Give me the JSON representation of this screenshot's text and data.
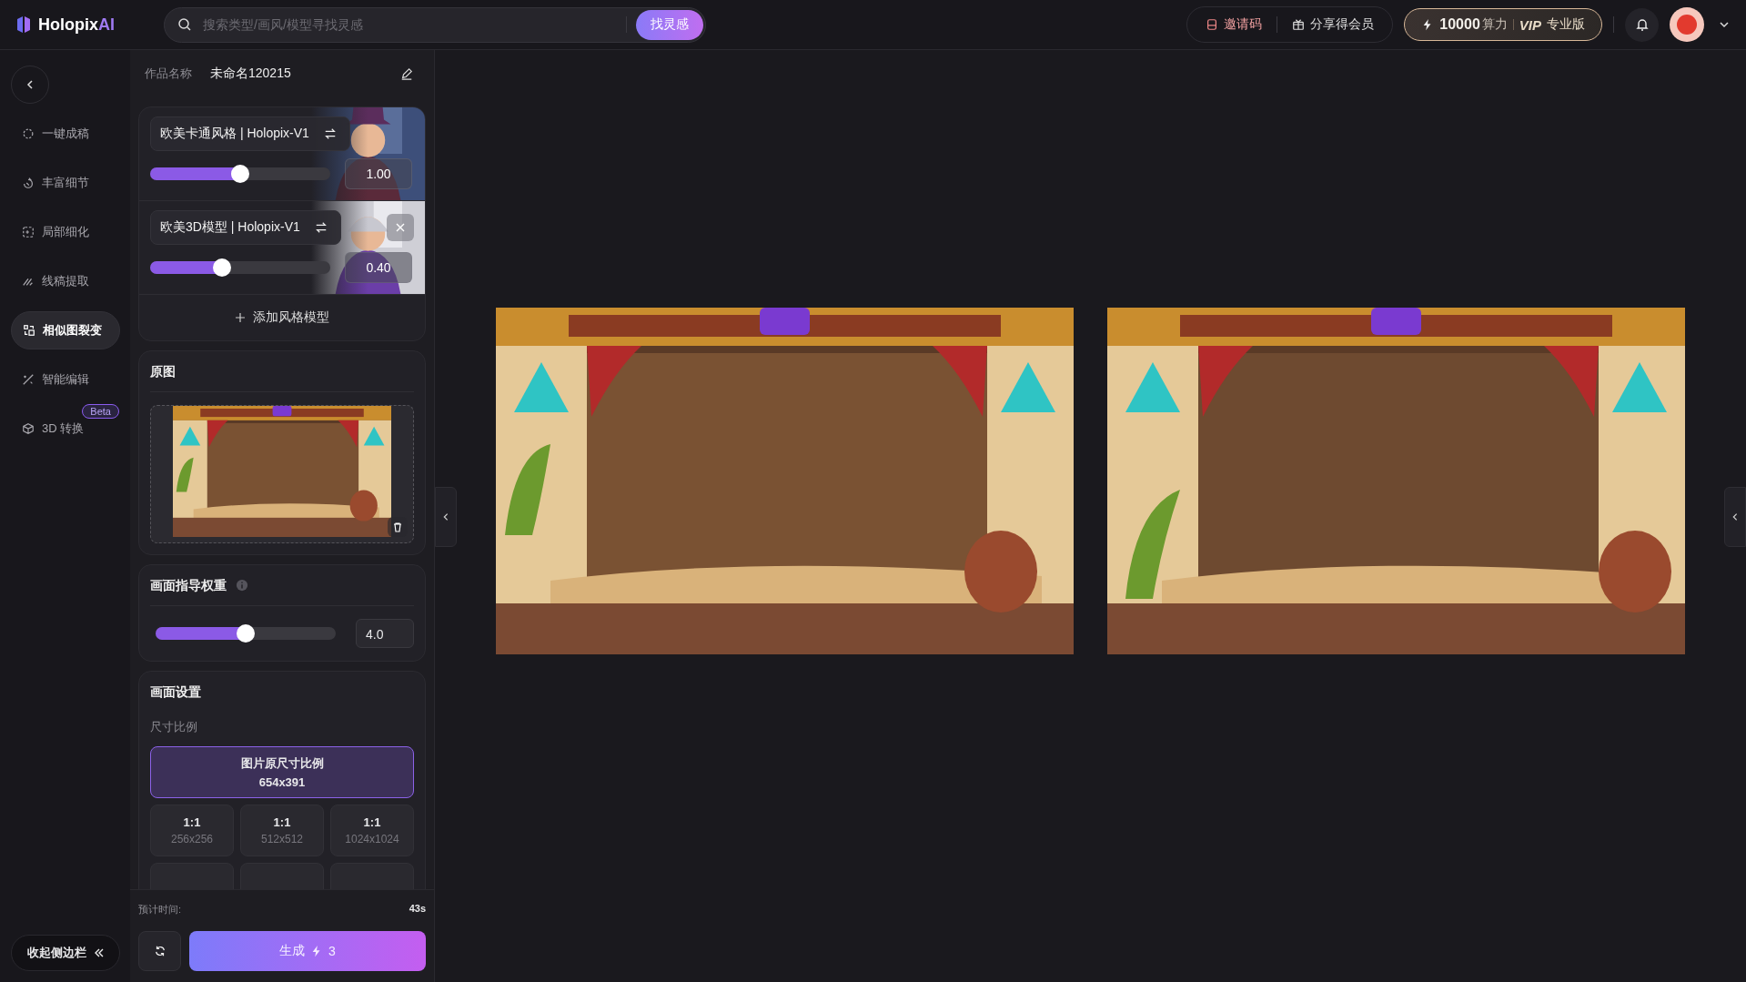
{
  "logo": {
    "name": "Holopix",
    "accent": "AI"
  },
  "search": {
    "placeholder": "搜索类型/画风/模型寻找灵感",
    "button": "找灵感"
  },
  "header": {
    "invite": "邀请码",
    "share": "分享得会员",
    "credits": "10000",
    "credits_unit": "算力",
    "vip": "VIP",
    "plan": "专业版"
  },
  "nav": [
    {
      "label": "一键成稿",
      "selected": false
    },
    {
      "label": "丰富细节",
      "selected": false
    },
    {
      "label": "局部细化",
      "selected": false
    },
    {
      "label": "线稿提取",
      "selected": false
    },
    {
      "label": "相似图裂变",
      "selected": true
    },
    {
      "label": "智能编辑",
      "selected": false
    },
    {
      "label": "3D 转换",
      "selected": false,
      "badge": "Beta"
    }
  ],
  "collapse": "收起侧边栏",
  "work": {
    "label": "作品名称",
    "value": "未命名120215"
  },
  "style_models": [
    {
      "name": "欧美卡通风格 | Holopix-V1",
      "level": 0.5,
      "reading": "1.00",
      "removable": false
    },
    {
      "name": "欧美3D模型 | Holopix-V1",
      "level": 0.4,
      "reading": "0.40",
      "removable": true
    }
  ],
  "add_model": "添加风格模型",
  "source": {
    "title": "原图"
  },
  "guidance": {
    "title": "画面指导权重",
    "level": 0.5,
    "value": "4.0"
  },
  "settings": {
    "title": "画面设置",
    "ratio_label": "尺寸比例",
    "original": {
      "label": "图片原尺寸比例",
      "size": "654x391",
      "selected": true
    },
    "options": [
      {
        "kind": "option",
        "ratio": "1:1",
        "size": "256x256",
        "selected": false
      },
      {
        "kind": "option",
        "ratio": "1:1",
        "size": "512x512",
        "selected": false
      },
      {
        "kind": "option",
        "ratio": "1:1",
        "size": "1024x1024",
        "selected": false
      },
      {
        "kind": "clipped"
      },
      {
        "kind": "clipped"
      },
      {
        "kind": "clipped"
      }
    ]
  },
  "estimate": {
    "label": "预计时间:",
    "value": "43s"
  },
  "generate": {
    "label": "生成",
    "cost": "3"
  }
}
